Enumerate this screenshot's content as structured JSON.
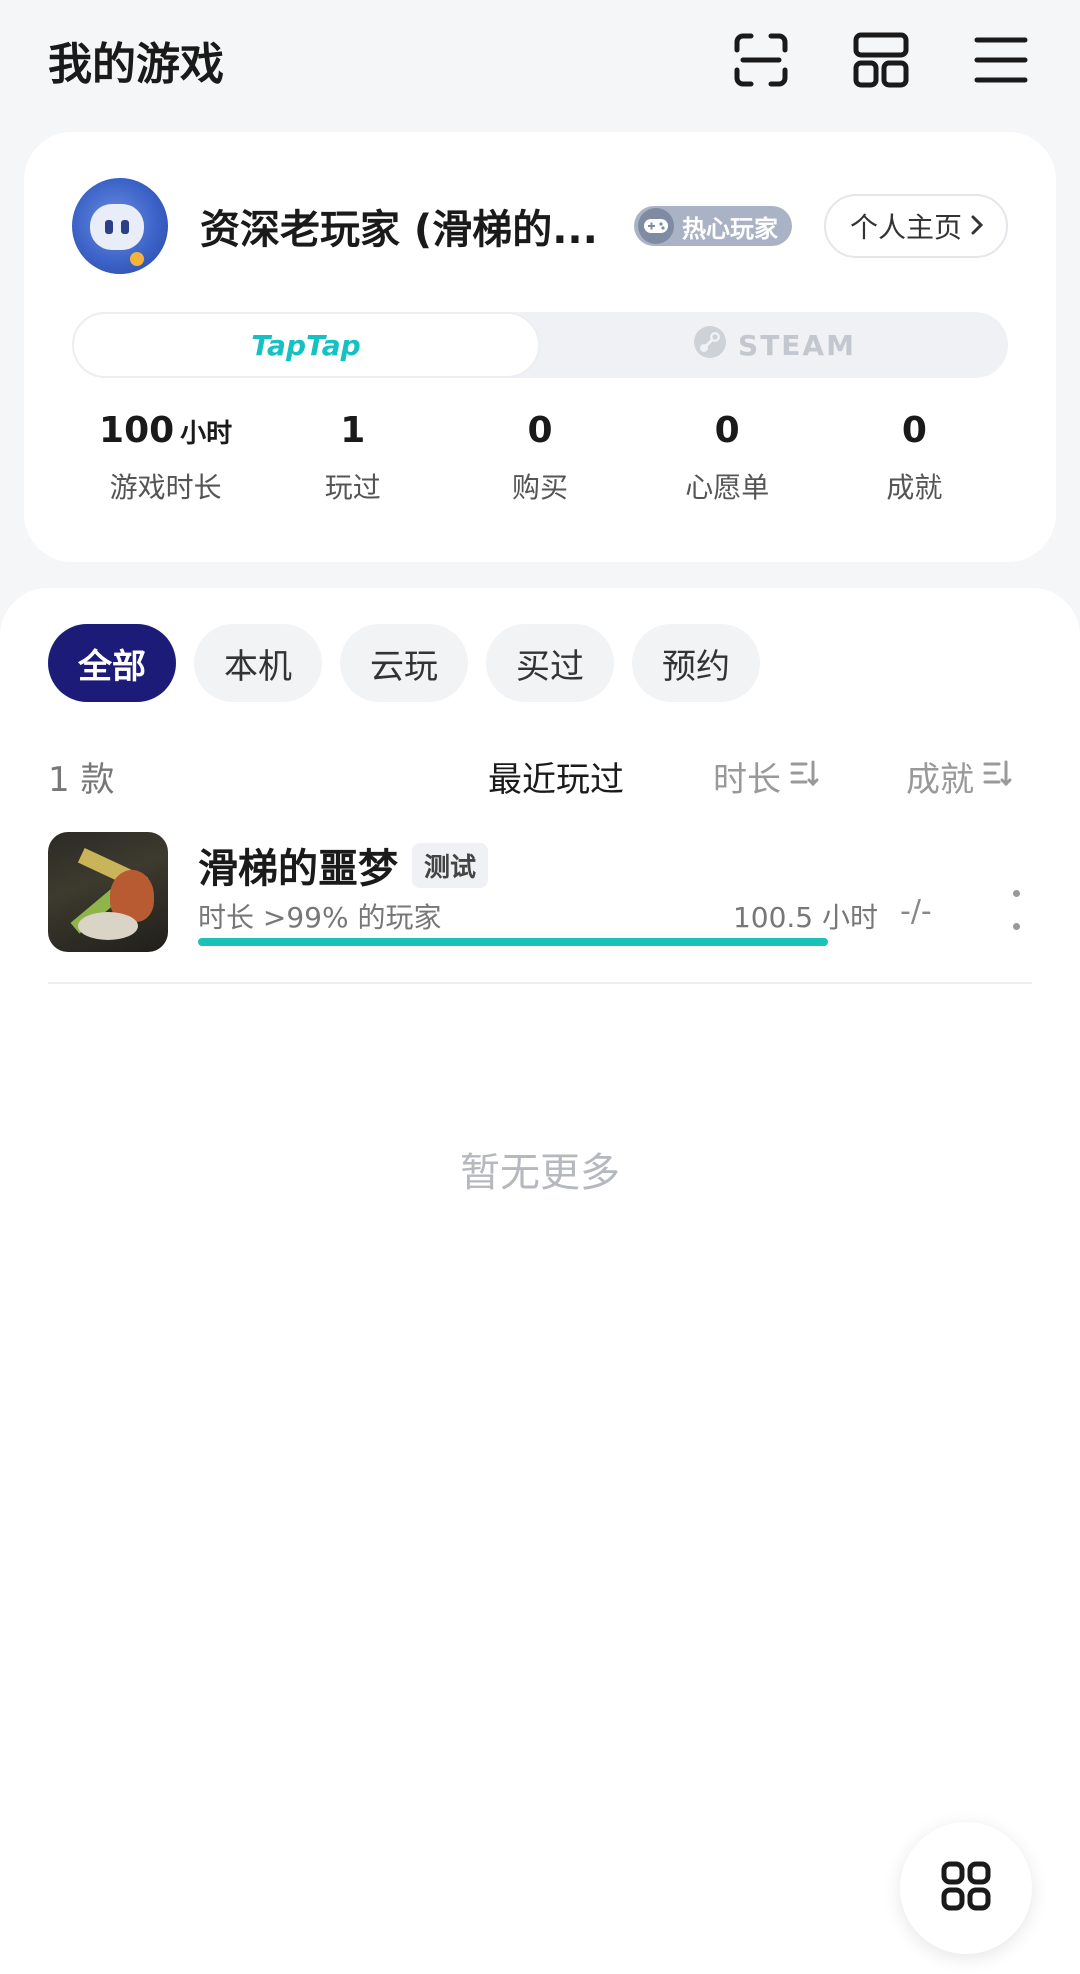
{
  "header": {
    "title": "我的游戏",
    "icons": [
      "scan-icon",
      "layout-icon",
      "menu-icon"
    ]
  },
  "profile": {
    "username": "资深老玩家 (滑梯的...",
    "badge": "热心玩家",
    "homepage_label": "个人主页",
    "platforms": {
      "taptap": "TapTap",
      "steam": "STEAM",
      "active": "TapTap"
    },
    "stats": [
      {
        "value": "100",
        "unit": "小时",
        "label": "游戏时长"
      },
      {
        "value": "1",
        "label": "玩过"
      },
      {
        "value": "0",
        "label": "购买"
      },
      {
        "value": "0",
        "label": "心愿单"
      },
      {
        "value": "0",
        "label": "成就"
      }
    ]
  },
  "filters": {
    "chips": [
      "全部",
      "本机",
      "云玩",
      "买过",
      "预约"
    ],
    "active": "全部"
  },
  "sort": {
    "count": "1 款",
    "recent": "最近玩过",
    "duration": "时长",
    "achievement": "成就"
  },
  "games": [
    {
      "name": "滑梯的噩梦",
      "tag": "测试",
      "rank_text": "时长 >99% 的玩家",
      "hours": "100.5 小时",
      "progress": 1.0,
      "achievement": "-/-"
    }
  ],
  "empty_text": "暂无更多",
  "colors": {
    "accent": "#1c1c78",
    "taptap": "#14c2c3",
    "progress": "#19c3b9",
    "badge": "#aab3c6"
  }
}
